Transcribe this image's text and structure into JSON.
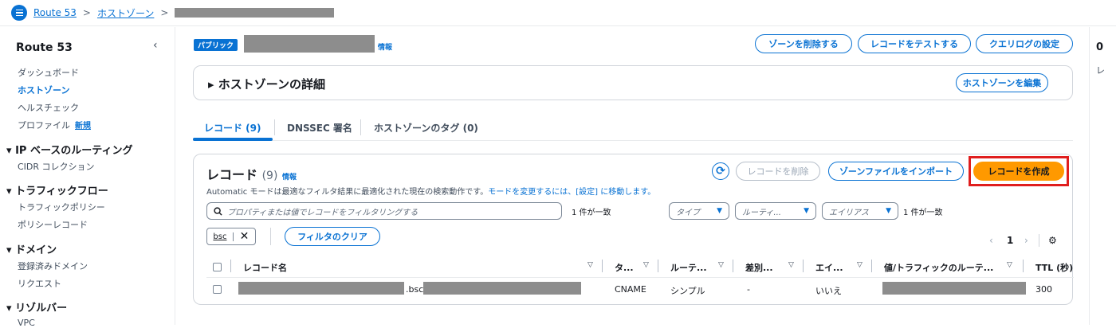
{
  "breadcrumb": {
    "items": [
      "Route 53",
      "ホストゾーン"
    ]
  },
  "sidebar": {
    "title": "Route 53",
    "items": [
      "ダッシュボード",
      "ホストゾーン",
      "ヘルスチェック",
      "プロファイル"
    ],
    "new_badge": "新規",
    "sections": [
      {
        "title": "IP ベースのルーティング",
        "items": [
          "CIDR コレクション"
        ]
      },
      {
        "title": "トラフィックフロー",
        "items": [
          "トラフィックポリシー",
          "ポリシーレコード"
        ]
      },
      {
        "title": "ドメイン",
        "items": [
          "登録済みドメイン",
          "リクエスト"
        ]
      },
      {
        "title": "リゾルバー",
        "items": [
          "VPC"
        ]
      }
    ]
  },
  "header": {
    "badge": "パブリック",
    "info": "情報",
    "buttons": {
      "delete_zone": "ゾーンを削除する",
      "test_record": "レコードをテストする",
      "query_log": "クエリログの設定"
    }
  },
  "details": {
    "title": "ホストゾーンの詳細",
    "edit_button": "ホストゾーンを編集"
  },
  "tabs": [
    "レコード (9)",
    "DNSSEC 署名",
    "ホストゾーンのタグ (0)"
  ],
  "records": {
    "title": "レコード",
    "count": "(9)",
    "info": "情報",
    "description": "Automatic モードは最適なフィルタ結果に最適化された現在の検索動作です。",
    "description_link": "モードを変更するには、[設定] に移動します。",
    "delete_button": "レコードを削除",
    "import_button": "ゾーンファイルをインポート",
    "create_button": "レコードを作成",
    "search_placeholder": "プロパティまたは値でレコードをフィルタリングする",
    "match_text": "1 件が一致",
    "filters": {
      "type": "タイプ",
      "routing": "ルーティ...",
      "alias": "エイリアス"
    },
    "match_text2": "1 件が一致",
    "token": "bsc",
    "clear_filter": "フィルタのクリア",
    "page": "1",
    "columns": [
      "レコード名",
      "タ...",
      "ルーテ...",
      "差別...",
      "エイ...",
      "値/トラフィックのルーテ...",
      "TTL (秒)"
    ],
    "rows": [
      {
        "name_mid": ".bsc.",
        "type": "CNAME",
        "routing": "シンプル",
        "diff": "-",
        "alias": "いいえ",
        "ttl": "300"
      }
    ]
  },
  "right_pane": {
    "label1": "0",
    "label2": "レ"
  },
  "colors": {
    "accent": "#0972d3",
    "primary": "#ff9900",
    "highlight": "#e01e1e",
    "redaction": "#8d8d8d"
  },
  "icons": [
    "menu-icon",
    "chevron-right-icon",
    "chevron-left-icon",
    "refresh-icon",
    "search-icon",
    "caret-down-icon",
    "close-icon",
    "settings-icon",
    "sort-icon"
  ]
}
